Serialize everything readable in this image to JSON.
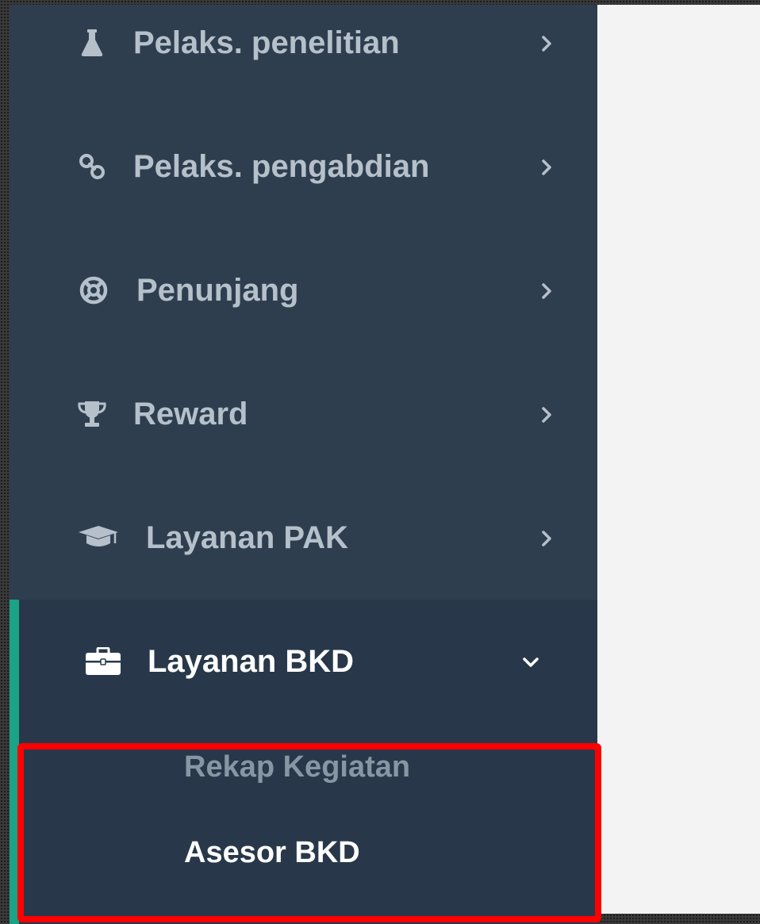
{
  "sidebar": {
    "items": [
      {
        "label": "Pelaks. penelitian",
        "icon": "flask-icon"
      },
      {
        "label": "Pelaks. pengabdian",
        "icon": "link-icon"
      },
      {
        "label": "Penunjang",
        "icon": "life-ring-icon"
      },
      {
        "label": "Reward",
        "icon": "trophy-icon"
      },
      {
        "label": "Layanan PAK",
        "icon": "graduation-cap-icon"
      },
      {
        "label": "Layanan BKD",
        "icon": "briefcase-icon",
        "expanded": true
      }
    ],
    "submenu": {
      "items": [
        {
          "label": "Rekap Kegiatan"
        },
        {
          "label": "Asesor BKD"
        }
      ]
    }
  },
  "colors": {
    "sidebar_bg": "#2f3e4f",
    "active_bg": "#28384a",
    "accent": "#1aa384",
    "text_inactive": "#b5c0ca",
    "text_active": "#ffffff",
    "highlight": "#ff0000",
    "content_bg": "#f3f3f3"
  }
}
